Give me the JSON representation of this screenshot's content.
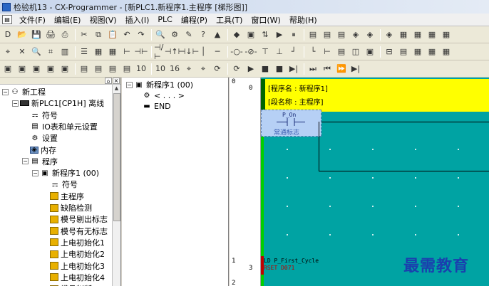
{
  "window": {
    "title": "检验机13 - CX-Programmer - [新PLC1.新程序1.主程序 [梯形图]]"
  },
  "menu": [
    "文件(F)",
    "编辑(E)",
    "视图(V)",
    "插入(I)",
    "PLC",
    "编程(P)",
    "工具(T)",
    "窗口(W)",
    "帮助(H)"
  ],
  "toolbar1": [
    "D",
    "📂",
    "💾",
    "🖨",
    "⎙",
    "✂",
    "⧉",
    "📋",
    "↶",
    "↷",
    "🔍",
    "⚙",
    "✎",
    "?",
    "▲",
    "◆",
    "▣",
    "⇅",
    "▶",
    "⏸",
    "▤",
    "▤",
    "▤",
    "◈",
    "◈",
    "◈",
    "▦",
    "▦",
    "▦",
    "▦"
  ],
  "toolbar2": [
    "⌖",
    "✕",
    "🔍",
    "⌗",
    "▥",
    "☰",
    "▦",
    "▦",
    "⊢",
    "⊣⊢",
    "⊣/⊢",
    "⊣↑⊢",
    "⊣↓⊢",
    "│",
    "─",
    "-○-",
    "-⊘-",
    "⊤",
    "⊥",
    "┘",
    "└",
    "⊢",
    "▤",
    "◫",
    "▣",
    "⊟",
    "▤",
    "▦",
    "▦",
    "▦"
  ],
  "toolbar3": [
    "▣",
    "▣",
    "▣",
    "▣",
    "▣",
    "▤",
    "▤",
    "▤",
    "▤",
    "10",
    "10",
    "16",
    "⌖",
    "⌖",
    "⟳",
    "⟳",
    "▶",
    "■",
    "■",
    "▶|",
    "⏭",
    "⏮",
    "⏩",
    "▶|"
  ],
  "project_tree": {
    "items": [
      {
        "label": "新工程",
        "indent": 0,
        "expander": "−",
        "icon": "network"
      },
      {
        "label": "新PLC1[CP1H] 离线",
        "indent": 1,
        "expander": "−",
        "icon": "plc"
      },
      {
        "label": "符号",
        "indent": 2,
        "expander": "",
        "icon": "sym"
      },
      {
        "label": "IO表和单元设置",
        "indent": 2,
        "expander": "",
        "icon": "io"
      },
      {
        "label": "设置",
        "indent": 2,
        "expander": "",
        "icon": "set"
      },
      {
        "label": "内存",
        "indent": 2,
        "expander": "",
        "icon": "mem"
      },
      {
        "label": "程序",
        "indent": 2,
        "expander": "−",
        "icon": "prog"
      },
      {
        "label": "新程序1 (00)",
        "indent": 3,
        "expander": "−",
        "icon": "prog1"
      },
      {
        "label": "符号",
        "indent": 4,
        "expander": "",
        "icon": "sym"
      },
      {
        "label": "主程序",
        "indent": 4,
        "expander": "",
        "icon": "sec"
      },
      {
        "label": "缺陷检测",
        "indent": 4,
        "expander": "",
        "icon": "sec"
      },
      {
        "label": "模号剔出标志",
        "indent": 4,
        "expander": "",
        "icon": "sec"
      },
      {
        "label": "模号有无标志",
        "indent": 4,
        "expander": "",
        "icon": "sec"
      },
      {
        "label": "上电初始化1",
        "indent": 4,
        "expander": "",
        "icon": "sec"
      },
      {
        "label": "上电初始化2",
        "indent": 4,
        "expander": "",
        "icon": "sec"
      },
      {
        "label": "上电初始化3",
        "indent": 4,
        "expander": "",
        "icon": "sec"
      },
      {
        "label": "上电初始化4",
        "indent": 4,
        "expander": "",
        "icon": "sec"
      },
      {
        "label": "模号判断",
        "indent": 4,
        "expander": "",
        "icon": "sec"
      }
    ]
  },
  "section_tree": {
    "items": [
      {
        "label": "新程序1 (00)",
        "indent": 0,
        "expander": "−"
      },
      {
        "label": "< . . . >",
        "indent": 1,
        "expander": ""
      },
      {
        "label": "END",
        "indent": 1,
        "expander": ""
      }
    ]
  },
  "ladder": {
    "gutter": [
      "0",
      "0",
      "1",
      "3",
      "2"
    ],
    "program_name": "[程序名 : 新程序1]",
    "section_name": "[段名称 : 主程序]",
    "contact_operand": "P_On",
    "contact_comment": "常通标志",
    "rung2_line1": "LD P_First_Cycle",
    "rung2_line2": "RSET D071"
  },
  "watermark": "最需教育"
}
